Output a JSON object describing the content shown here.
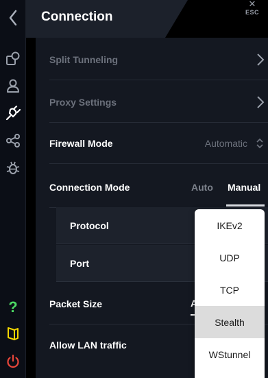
{
  "header": {
    "title": "Connection",
    "esc_label": "ESC"
  },
  "rail": {
    "icons": [
      "back-arrow-icon",
      "locations-icon",
      "account-icon",
      "connection-plug-icon",
      "share-icon",
      "debug-bug-icon",
      "help-question-icon",
      "news-book-icon",
      "power-icon"
    ],
    "colors": {
      "help": "#4cd964",
      "news": "#f5d800",
      "power": "#e8463a"
    }
  },
  "settings": {
    "split_tunneling": "Split Tunneling",
    "proxy_settings": "Proxy Settings",
    "firewall_mode": {
      "label": "Firewall Mode",
      "value": "Automatic"
    },
    "connection_mode": {
      "label": "Connection Mode",
      "options": [
        "Auto",
        "Manual"
      ],
      "selected": "Manual"
    },
    "protocol": {
      "label": "Protocol"
    },
    "port": {
      "label": "Port"
    },
    "packet_size": {
      "label": "Packet Size",
      "value_partial": "A"
    },
    "allow_lan": {
      "label": "Allow LAN traffic"
    }
  },
  "protocol_dropdown": {
    "options": [
      "IKEv2",
      "UDP",
      "TCP",
      "Stealth",
      "WStunnel"
    ],
    "highlighted": "Stealth"
  }
}
